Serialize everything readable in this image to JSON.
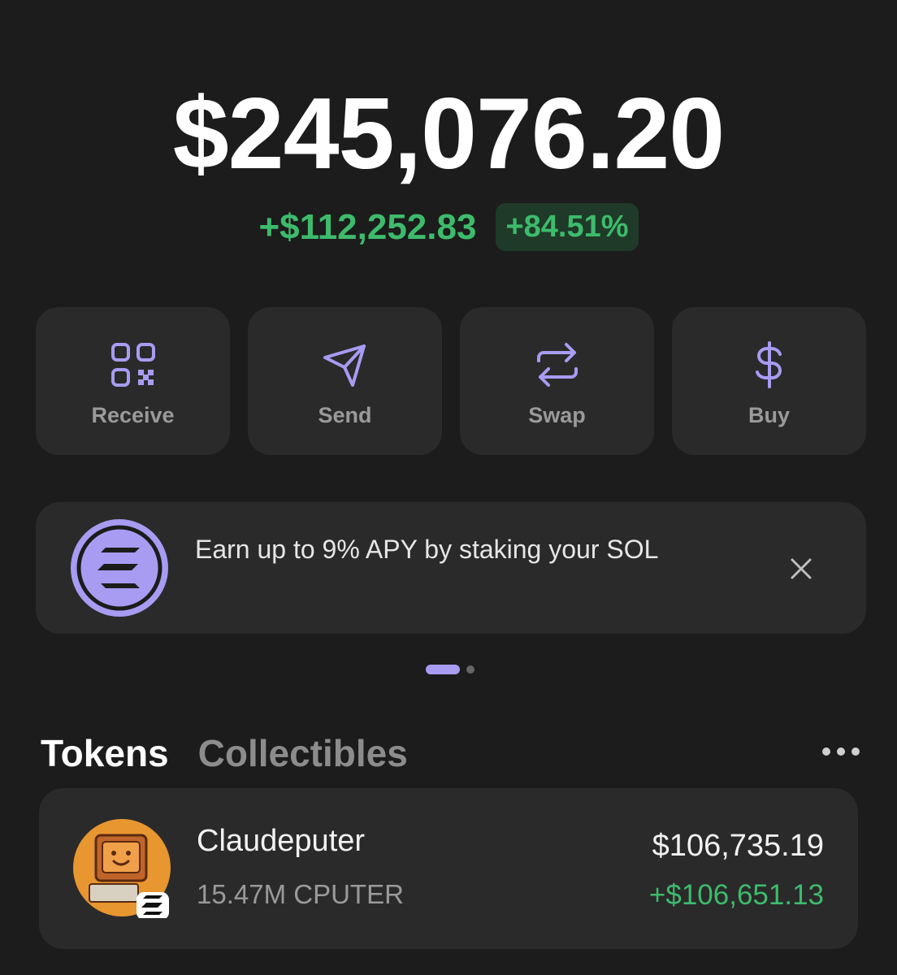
{
  "balance": {
    "total": "$245,076.20",
    "change_amount": "+$112,252.83",
    "change_percent": "+84.51%"
  },
  "actions": [
    {
      "label": "Receive",
      "icon": "qr-code-icon"
    },
    {
      "label": "Send",
      "icon": "paper-plane-icon"
    },
    {
      "label": "Swap",
      "icon": "swap-arrows-icon"
    },
    {
      "label": "Buy",
      "icon": "dollar-icon"
    }
  ],
  "banner": {
    "text": "Earn up to 9% APY by staking your SOL",
    "icon": "solana-logo-icon"
  },
  "carousel": {
    "pages": 2,
    "active": 1
  },
  "tabs": {
    "active": "Tokens",
    "inactive": "Collectibles"
  },
  "tokens": [
    {
      "name": "Claudeputer",
      "amount": "15.47M CPUTER",
      "value": "$106,735.19",
      "change": "+$106,651.13"
    }
  ],
  "colors": {
    "background": "#1c1c1c",
    "card": "#2a2a2a",
    "accent": "#a79cf2",
    "positive": "#3dbb6c"
  }
}
